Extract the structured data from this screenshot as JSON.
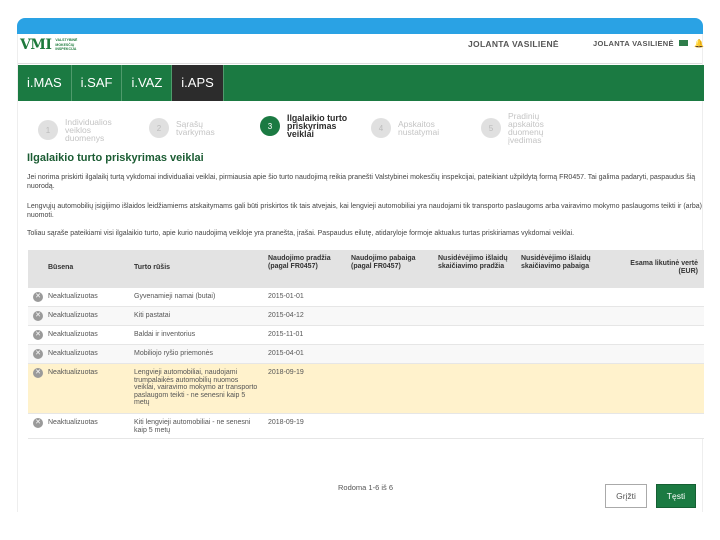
{
  "header": {
    "logo_mark": "VMI",
    "logo_text": "VALSTYBINĖ MOKESČIŲ INSPEKCIJA",
    "user_primary": "JOLANTA VASILIENĖ",
    "user_secondary": "JOLANTA VASILIENĖ"
  },
  "nav": [
    {
      "label": "i.MAS"
    },
    {
      "label": "i.SAF"
    },
    {
      "label": "i.VAZ"
    },
    {
      "label": "i.APS"
    }
  ],
  "stepper": [
    {
      "num": "1",
      "label": "Individualios veiklos duomenys"
    },
    {
      "num": "2",
      "label": "Sąrašų tvarkymas"
    },
    {
      "num": "3",
      "label": "Ilgalaikio turto priskyrimas veiklai"
    },
    {
      "num": "4",
      "label": "Apskaitos nustatymai"
    },
    {
      "num": "5",
      "label": "Pradinių apskaitos duomenų įvedimas"
    }
  ],
  "page": {
    "title": "Ilgalaikio turto priskyrimas veiklai",
    "paragraph1": "Jei norima priskirti ilgalaikį turtą vykdomai individualiai veiklai, pirmiausia apie šio turto naudojimą reikia pranešti Valstybinei mokesčių inspekcijai, pateikiant užpildytą formą FR0457. Tai galima padaryti, paspaudus šią nuorodą.",
    "paragraph2": "Lengvųjų automobilių įsigijimo išlaidos leidžiamiems atskaitymams gali būti priskirtos tik tais atvejais, kai lengvieji automobiliai yra naudojami tik transporto paslaugoms arba vairavimo mokymo paslaugoms teikti ir (arba) nuomoti.",
    "paragraph3": "Toliau sąraše pateikiami visi ilgalaikio turto, apie kurio naudojimą veikloje yra pranešta, įrašai. Paspaudus eilutę, atidaryloje formoje aktualus turtas priskiriamas vykdomai veiklai."
  },
  "table": {
    "headers": {
      "status": "Būsena",
      "type": "Turto rūšis",
      "start": "Naudojimo pradžia (pagal FR0457)",
      "end": "Naudojimo pabaiga (pagal FR0457)",
      "s1": "Nusidėvėjimo išlaidų skaičiavimo pradžia",
      "s2": "Nusidėvėjimo išlaidų skaičiavimo pabaiga",
      "value": "Esama likutinė vertė (EUR)"
    },
    "rows": [
      {
        "status": "Neaktualizuotas",
        "type": "Gyvenamieji namai (butai)",
        "start": "2015-01-01"
      },
      {
        "status": "Neaktualizuotas",
        "type": "Kiti pastatai",
        "start": "2015-04-12"
      },
      {
        "status": "Neaktualizuotas",
        "type": "Baldai ir inventorius",
        "start": "2015-11-01"
      },
      {
        "status": "Neaktualizuotas",
        "type": "Mobiliojo ryšio priemonės",
        "start": "2015-04-01"
      },
      {
        "status": "Neaktualizuotas",
        "type": "Lengvieji automobiliai, naudojami trumpalaikės automobilių nuomos veiklai, vairavimo mokymo ar transporto paslaugom teikti - ne senesni kaip 5 metų",
        "start": "2018-09-19"
      },
      {
        "status": "Neaktualizuotas",
        "type": "Kiti lengvieji automobiliai - ne senesni kaip 5 metų",
        "start": "2018-09-19"
      }
    ]
  },
  "pager": {
    "text": "Rodoma 1-6 iš 6"
  },
  "buttons": {
    "back": "Grįžti",
    "next": "Tęsti"
  },
  "colors": {
    "brand_green": "#1b7a42",
    "top_bar": "#2aa2e4",
    "highlight_row": "#fff2cc"
  }
}
